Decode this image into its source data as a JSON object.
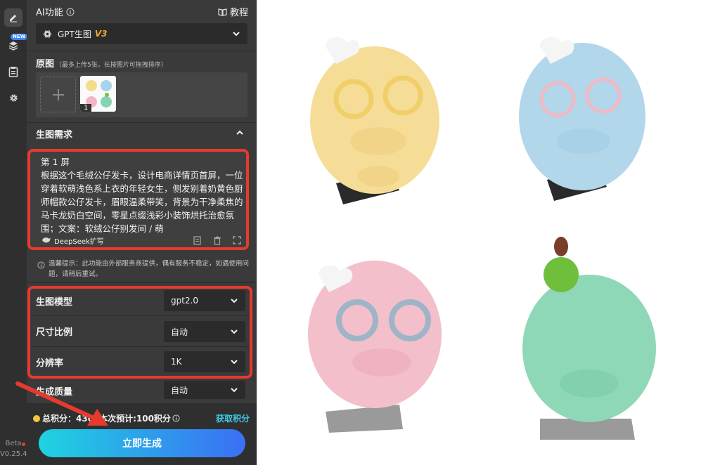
{
  "ai_header": {
    "title": "AI功能",
    "tutorial_label": "教程"
  },
  "version_select": {
    "label": "GPT生图",
    "version": "V3"
  },
  "source": {
    "title": "原图",
    "hint": "（最多上传5张，长按图片可拖拽排序）",
    "thumb_index": "1"
  },
  "requirements": {
    "title": "生图需求",
    "text": "第 1 屏\n根据这个毛绒公仔发卡，设计电商详情页首屏，一位穿着软萌浅色系上衣的年轻女生，侧发别着奶黄色厨师帽款公仔发卡，眉眼温柔带笑，背景为干净柔焦的马卡龙奶白空间，零星点缀浅彩小装饰烘托治愈氛围；文案：软绒公仔别发间 / 萌",
    "deepseek_label": "DeepSeek扩写"
  },
  "notice": {
    "text": "温馨提示：此功能由外部服务商提供，偶有服务不稳定，如遇使用问题，请稍后重试。"
  },
  "options": [
    {
      "label": "生图模型",
      "value": "gpt2.0"
    },
    {
      "label": "尺寸比例",
      "value": "自动"
    },
    {
      "label": "分辨率",
      "value": "1K"
    },
    {
      "label": "生成质量",
      "value": "自动"
    }
  ],
  "points": {
    "total_label": "总积分：",
    "total_value": "430",
    "estimate": "本次预计:100积分",
    "get_points": "获取积分"
  },
  "generate_button": "立即生成",
  "beta": {
    "label": "Beta",
    "version": "V0.25.4"
  },
  "sidebar": {
    "new_badge": "NEW"
  },
  "colors": {
    "accent_blue": "#3d84f7",
    "highlight_red": "#e63a2e",
    "version_gold": "#e8a93a",
    "link_cyan": "#3ec8e6",
    "button_gradient_start": "#1fd3e0",
    "button_gradient_end": "#3b6ff5"
  },
  "preview_image": {
    "description_icon": "image-icon"
  }
}
